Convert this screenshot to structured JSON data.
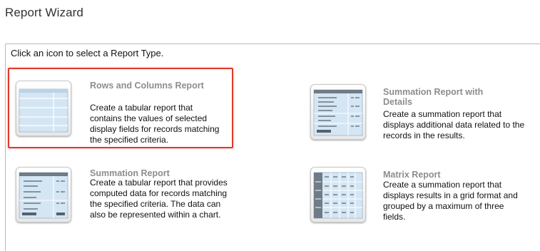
{
  "header": {
    "title": "Report Wizard"
  },
  "instruction": "Click an icon to select a Report Type.",
  "options": [
    {
      "name": "Rows and Columns Report",
      "description": "Create a tabular report that contains the values of selected display fields for records matching the specified criteria.",
      "icon": "rows-columns-icon",
      "selected": true
    },
    {
      "name": "Summation Report with Details",
      "description": "Create a summation report that displays additional data related to the records in the results.",
      "icon": "summation-details-icon",
      "selected": false
    },
    {
      "name": "Summation Report",
      "description": "Create a tabular report that provides computed data for records matching the specified criteria. The data can also be represented within a chart.",
      "icon": "summation-icon",
      "selected": false
    },
    {
      "name": "Matrix Report",
      "description": "Create a summation report that displays results in a grid format and grouped by a maximum of three fields.",
      "icon": "matrix-icon",
      "selected": false
    }
  ],
  "colors": {
    "highlight": "#e03a2a",
    "option_title": "#8d8d8d",
    "icon_blue": "#cfe2f1"
  }
}
